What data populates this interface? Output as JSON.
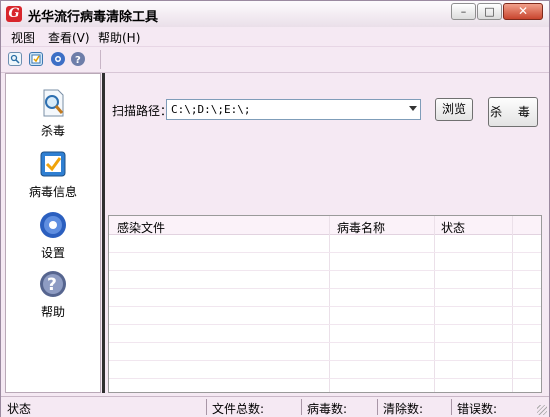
{
  "window": {
    "title": "光华流行病毒清除工具",
    "icon": "app-logo-G"
  },
  "menu": [
    {
      "label": "视图"
    },
    {
      "label": "查看(V)"
    },
    {
      "label": "帮助(H)"
    }
  ],
  "toolbar": {
    "icons": [
      "scan-doc-icon",
      "virus-info-icon",
      "settings-gear-icon",
      "help-icon"
    ]
  },
  "sidebar": {
    "items": [
      {
        "label": "杀毒",
        "icon": "magnifier-doc-icon"
      },
      {
        "label": "病毒信息",
        "icon": "virus-info-icon"
      },
      {
        "label": "设置",
        "icon": "gear-icon"
      },
      {
        "label": "帮助",
        "icon": "help-icon"
      }
    ]
  },
  "scan": {
    "path_label": "扫描路径：",
    "path_value": "C:\\;D:\\;E:\\;",
    "browse_label": "浏览",
    "kill_label": "杀 毒"
  },
  "results": {
    "columns": [
      "感染文件",
      "病毒名称",
      "状态"
    ],
    "rows": []
  },
  "status": {
    "state_label": "状态",
    "total_files_label": "文件总数:",
    "virus_count_label": "病毒数:",
    "cleaned_count_label": "清除数:",
    "error_count_label": "错误数:"
  },
  "colors": {
    "frame_bg": "#f5e9f3",
    "logo_red": "#d8262c",
    "close_button": "#c8452e"
  }
}
